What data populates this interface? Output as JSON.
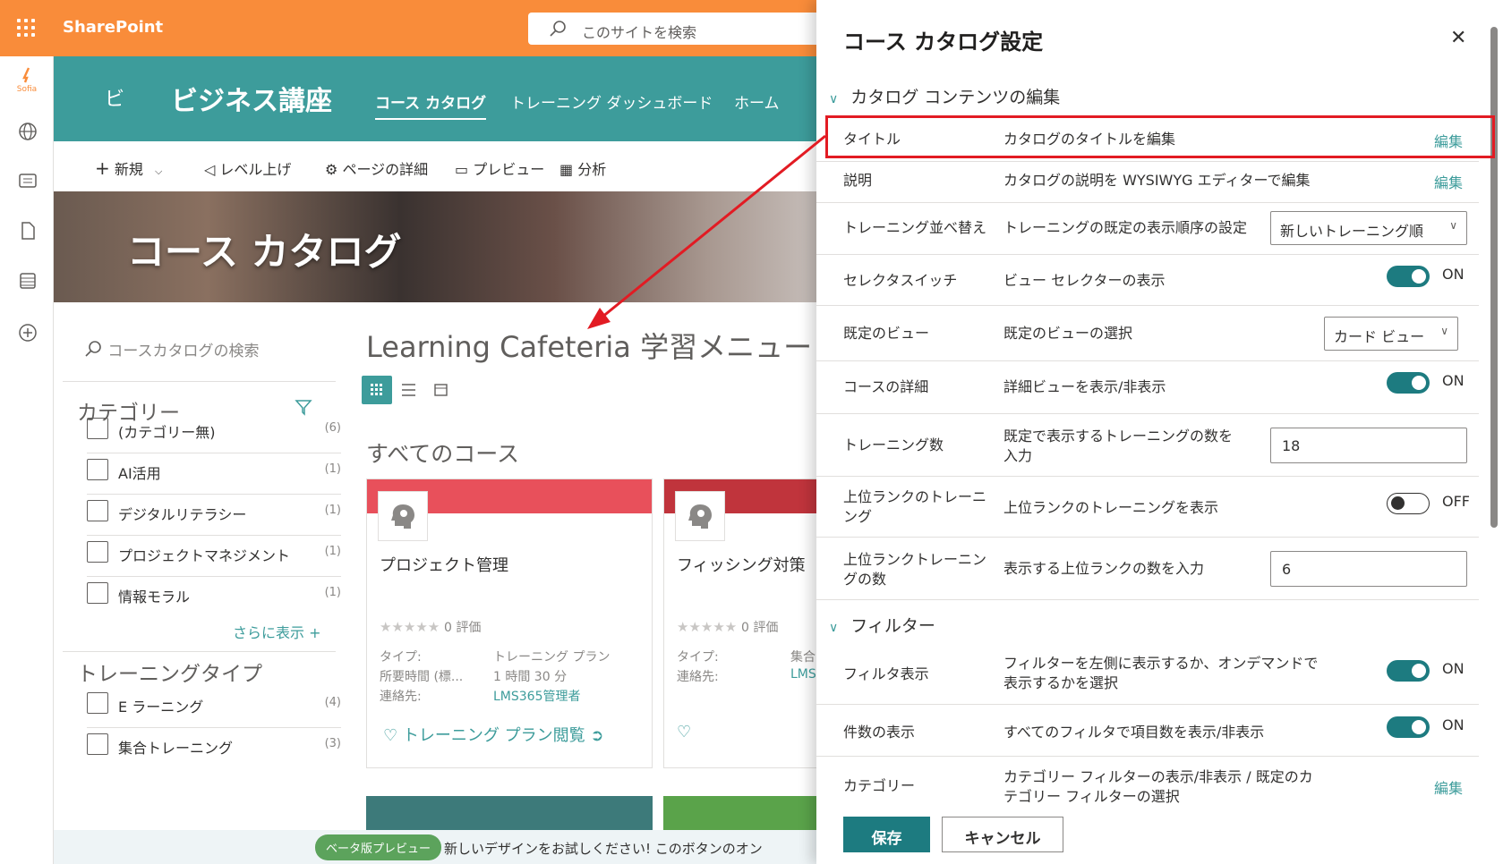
{
  "suite": {
    "app_name": "SharePoint",
    "search_placeholder": "このサイトを検索"
  },
  "rail": {
    "logo_text": "Sofia"
  },
  "site": {
    "icon_letter": "ビ",
    "title": "ビジネス講座",
    "nav": [
      "コース カタログ",
      "トレーニング ダッシュボード",
      "ホーム"
    ]
  },
  "commands": {
    "new": "新規",
    "promote": "レベル上げ",
    "page_details": "ページの詳細",
    "preview": "プレビュー",
    "analytics": "分析"
  },
  "hero": {
    "title": "コース カタログ"
  },
  "filter": {
    "search_placeholder": "コースカタログの検索",
    "category_heading": "カテゴリー",
    "categories": [
      {
        "label": "(カテゴリー無)",
        "count": "(6)"
      },
      {
        "label": "AI活用",
        "count": "(1)"
      },
      {
        "label": "デジタルリテラシー",
        "count": "(1)"
      },
      {
        "label": "プロジェクトマネジメント",
        "count": "(1)"
      },
      {
        "label": "情報モラル",
        "count": "(1)"
      }
    ],
    "show_more": "さらに表示 +",
    "type_heading": "トレーニングタイプ",
    "types": [
      {
        "label": "E ラーニング",
        "count": "(4)"
      },
      {
        "label": "集合トレーニング",
        "count": "(3)"
      }
    ]
  },
  "main": {
    "title": "Learning Cafeteria 学習メニュー",
    "section": "すべてのコース",
    "cards": [
      {
        "title": "プロジェクト管理",
        "rating": "0 評価",
        "type_label": "タイプ:",
        "type_value": "トレーニング プラン",
        "time_label": "所要時間 (標...",
        "time_value": "1 時間 30 分",
        "contact_label": "連絡先:",
        "contact_value": "LMS365管理者",
        "action": "トレーニング プラン閲覧",
        "band": "#e8505b"
      },
      {
        "title": "フィッシング対策",
        "rating": "0 評価",
        "type_label": "タイプ:",
        "type_value": "集合",
        "contact_label": "連絡先:",
        "contact_value": "LMS",
        "band": "#c0343c"
      }
    ]
  },
  "banner": {
    "badge": "ベータ版プレビュー",
    "text": "新しいデザインをお試しください! このボタンのオン"
  },
  "panel": {
    "title": "コース カタログ設定",
    "group_content": "カタログ コンテンツの編集",
    "group_filter": "フィルター",
    "rows": {
      "title": {
        "label": "タイトル",
        "desc": "カタログのタイトルを編集",
        "action": "編集"
      },
      "description": {
        "label": "説明",
        "desc": "カタログの説明を WYSIWYG エディターで編集",
        "action": "編集"
      },
      "sort": {
        "label": "トレーニング並べ替え",
        "desc": "トレーニングの既定の表示順序の設定",
        "value": "新しいトレーニング順"
      },
      "selector": {
        "label": "セレクタスイッチ",
        "desc": "ビュー セレクターの表示",
        "state": "ON"
      },
      "default_view": {
        "label": "既定のビュー",
        "desc": "既定のビューの選択",
        "value": "カード ビュー"
      },
      "details": {
        "label": "コースの詳細",
        "desc": "詳細ビューを表示/非表示",
        "state": "ON"
      },
      "count": {
        "label": "トレーニング数",
        "desc": "既定で表示するトレーニングの数を入力",
        "value": "18"
      },
      "top": {
        "label": "上位ランクのトレーニング",
        "desc": "上位ランクのトレーニングを表示",
        "state": "OFF"
      },
      "top_count": {
        "label": "上位ランクトレーニングの数",
        "desc": "表示する上位ランクの数を入力",
        "value": "6"
      },
      "filter_display": {
        "label": "フィルタ表示",
        "desc": "フィルターを左側に表示するか、オンデマンドで表示するかを選択",
        "state": "ON"
      },
      "count_display": {
        "label": "件数の表示",
        "desc": "すべてのフィルタで項目数を表示/非表示",
        "state": "ON"
      },
      "category": {
        "label": "カテゴリー",
        "desc": "カテゴリー フィルターの表示/非表示 / 既定のカテゴリー フィルターの選択",
        "action": "編集"
      }
    },
    "save": "保存",
    "cancel": "キャンセル"
  },
  "colors": {
    "suite": "#f98c3a",
    "site": "#3d9c9b",
    "accent": "#1d7b80",
    "highlight": "#e21b23"
  }
}
